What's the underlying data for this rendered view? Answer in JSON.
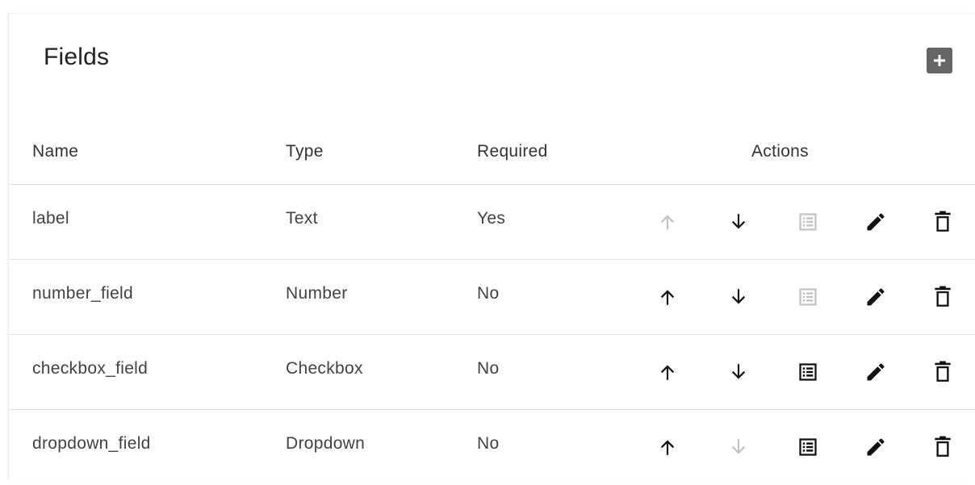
{
  "card": {
    "title": "Fields",
    "add_icon": "plus-square-icon"
  },
  "table": {
    "columns": {
      "name": "Name",
      "type": "Type",
      "required": "Required",
      "actions": "Actions"
    },
    "rows": [
      {
        "name": "label",
        "type": "Text",
        "required": "Yes",
        "up_enabled": false,
        "down_enabled": true,
        "options_enabled": false
      },
      {
        "name": "number_field",
        "type": "Number",
        "required": "No",
        "up_enabled": true,
        "down_enabled": true,
        "options_enabled": false
      },
      {
        "name": "checkbox_field",
        "type": "Checkbox",
        "required": "No",
        "up_enabled": true,
        "down_enabled": true,
        "options_enabled": true
      },
      {
        "name": "dropdown_field",
        "type": "Dropdown",
        "required": "No",
        "up_enabled": true,
        "down_enabled": false,
        "options_enabled": true
      }
    ]
  },
  "icons": {
    "up": "arrow-up-icon",
    "down": "arrow-down-icon",
    "options": "list-icon",
    "edit": "pencil-icon",
    "delete": "trash-icon"
  },
  "colors": {
    "icon_active": "#111111",
    "icon_disabled": "#c4c4c4",
    "add_button_bg": "#666666",
    "divider": "#e0e0e0"
  }
}
